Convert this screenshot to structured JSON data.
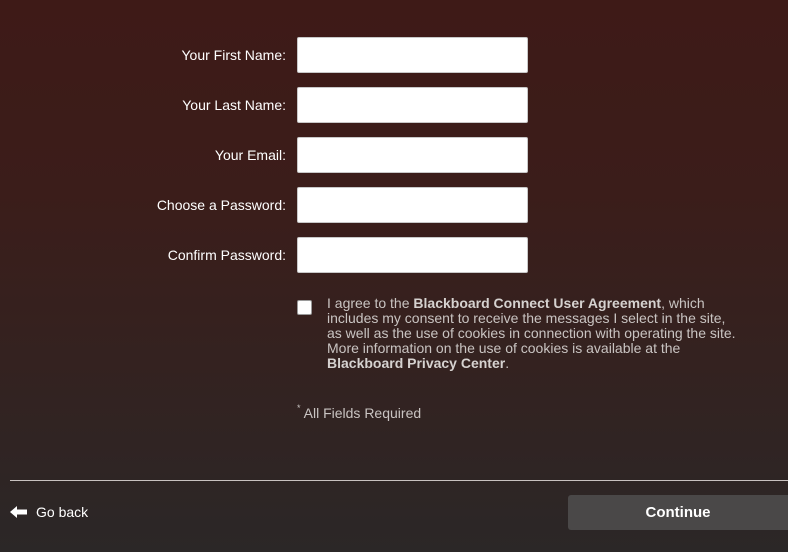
{
  "fields": [
    {
      "label": "Your First Name:",
      "value": "",
      "type": "text"
    },
    {
      "label": "Your Last Name:",
      "value": "",
      "type": "text"
    },
    {
      "label": "Your Email:",
      "value": "",
      "type": "email"
    },
    {
      "label": "Choose a Password:",
      "value": "",
      "type": "password"
    },
    {
      "label": "Confirm Password:",
      "value": "",
      "type": "password"
    }
  ],
  "agreement": {
    "checked": false,
    "text_intro": "I agree to the ",
    "user_agreement_link": "Blackboard Connect User Agreement",
    "text_middle": ", which includes my consent to receive the messages I select in the site, as well as the use of cookies in connection with operating the site. More information on the use of cookies is available at the ",
    "privacy_link": "Blackboard Privacy Center",
    "text_end": "."
  },
  "required_note": {
    "star": "*",
    "text": "All Fields Required"
  },
  "footer": {
    "go_back_label": "Go back",
    "go_back_icon": "arrow-left-icon",
    "continue_label": "Continue"
  },
  "colors": {
    "background_top": "#3e1a17",
    "background_bottom": "#2b2727",
    "continue_button": "#4a4848",
    "label_text": "#ffffff",
    "body_text": "#c9c4c2"
  }
}
